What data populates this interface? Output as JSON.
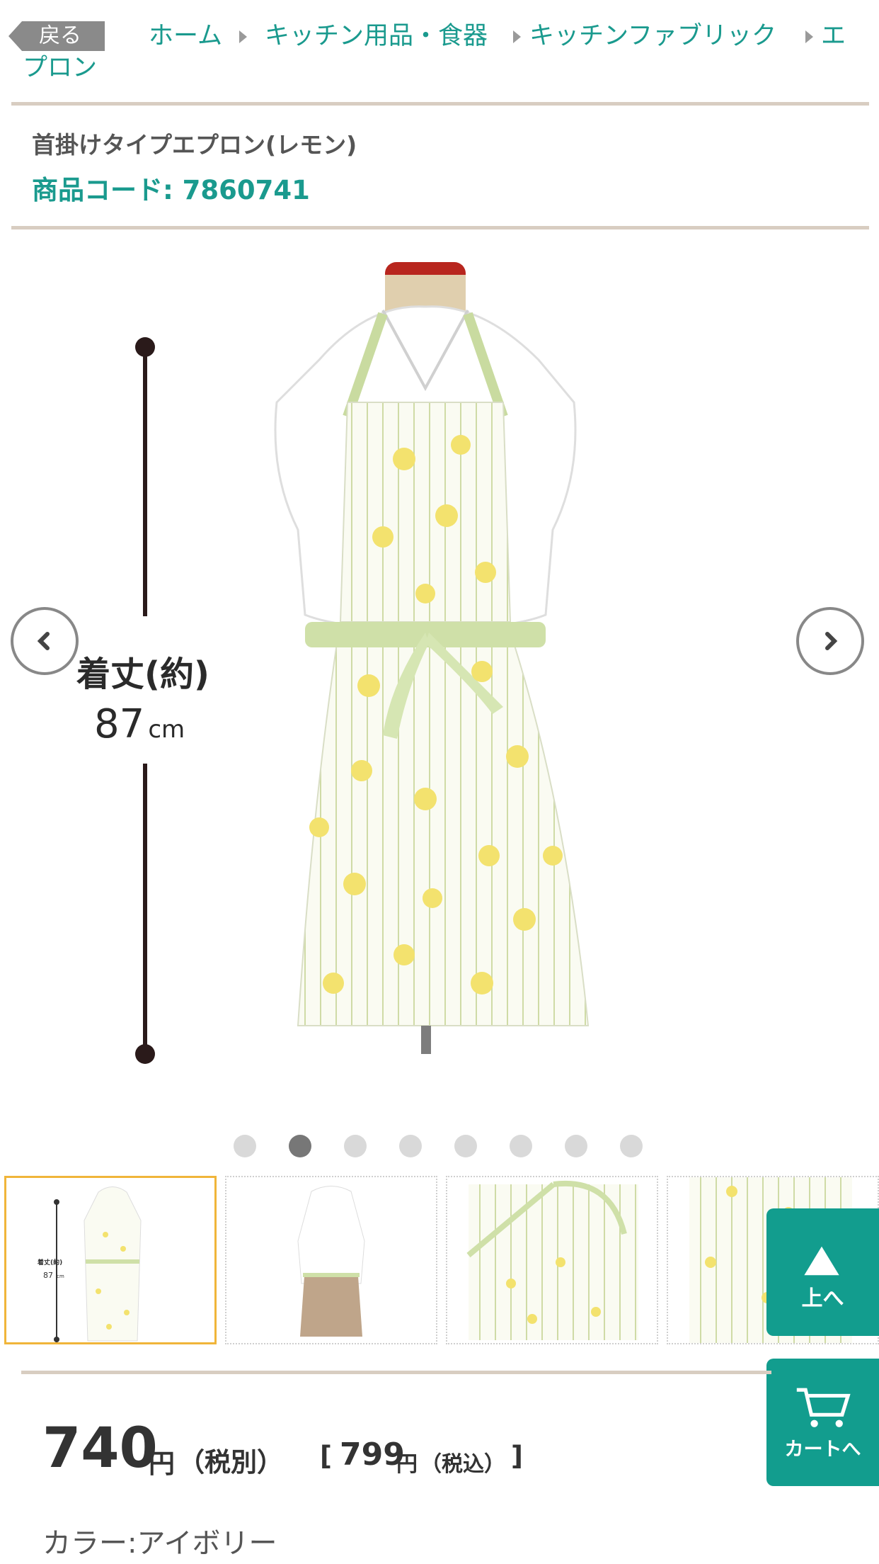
{
  "breadcrumb": {
    "back_label": "戻る",
    "home": "ホーム",
    "cat1": "キッチン用品・食器",
    "cat2": "キッチンファブリック",
    "cat3_line1": "エ",
    "cat3_line2": "プロン"
  },
  "product": {
    "title": "首掛けタイプエプロン(レモン)",
    "code_label": "商品コード: 7860741",
    "length_label": "着丈(約)",
    "length_value": "87",
    "length_unit": "cm",
    "thumb_length_label": "着丈(約)",
    "thumb_length_value": "87",
    "thumb_length_unit": "cm"
  },
  "carousel": {
    "count": 8,
    "active_index": 1
  },
  "floating": {
    "top_label": "上へ",
    "cart_label": "カートへ"
  },
  "price": {
    "amount": "740",
    "unit": "円",
    "tax_excl": "（税別）",
    "bracket_open": "[",
    "amount_incl": "799",
    "unit_incl": "円",
    "tax_incl": "（税込）",
    "bracket_close": "]"
  },
  "color": "カラー:アイボリー",
  "colors": {
    "accent": "#1a9a8e",
    "float_bg": "#129d8e",
    "rule": "#d8cdc1",
    "active_thumb": "#f0b53a"
  }
}
